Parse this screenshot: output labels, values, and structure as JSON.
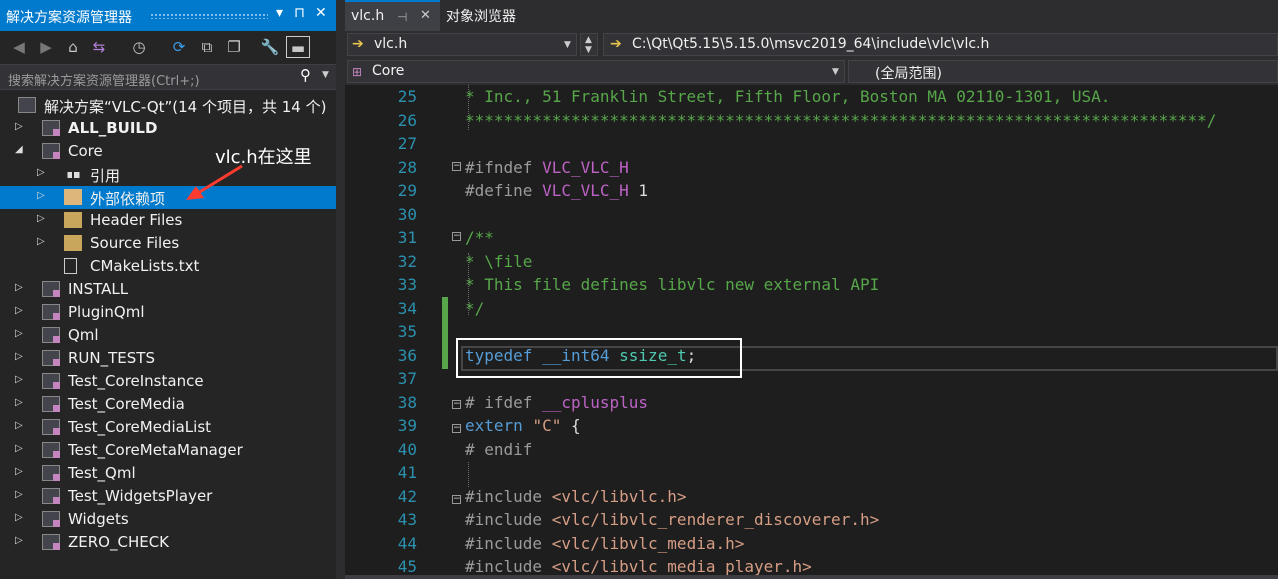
{
  "solution_explorer": {
    "title": "解决方案资源管理器",
    "title_buttons": [
      "▾",
      "⊓",
      "✕"
    ],
    "search_placeholder": "搜索解决方案资源管理器(Ctrl+;)",
    "tree": [
      {
        "label": "解决方案“VLC-Qt”(14 个项目，共 14 个)",
        "level": 0,
        "arrow": "",
        "icon": "solution-icon",
        "bold": false,
        "selected": false
      },
      {
        "label": "ALL_BUILD",
        "level": 1,
        "arrow": "▷",
        "icon": "project-icon",
        "bold": true,
        "selected": false
      },
      {
        "label": "Core",
        "level": 1,
        "arrow": "◢",
        "icon": "project-icon",
        "bold": false,
        "selected": false
      },
      {
        "label": "引用",
        "level": 2,
        "arrow": "▷",
        "icon": "references-icon",
        "bold": false,
        "selected": false
      },
      {
        "label": "外部依赖项",
        "level": 2,
        "arrow": "▷",
        "icon": "folder-icon",
        "bold": false,
        "selected": true
      },
      {
        "label": "Header Files",
        "level": 2,
        "arrow": "▷",
        "icon": "filter-folder-icon",
        "bold": false,
        "selected": false
      },
      {
        "label": "Source Files",
        "level": 2,
        "arrow": "▷",
        "icon": "filter-folder-icon",
        "bold": false,
        "selected": false
      },
      {
        "label": "CMakeLists.txt",
        "level": 2,
        "arrow": "",
        "icon": "text-file-icon",
        "bold": false,
        "selected": false
      },
      {
        "label": "INSTALL",
        "level": 1,
        "arrow": "▷",
        "icon": "project-icon",
        "bold": false,
        "selected": false
      },
      {
        "label": "PluginQml",
        "level": 1,
        "arrow": "▷",
        "icon": "project-icon",
        "bold": false,
        "selected": false
      },
      {
        "label": "Qml",
        "level": 1,
        "arrow": "▷",
        "icon": "project-icon",
        "bold": false,
        "selected": false
      },
      {
        "label": "RUN_TESTS",
        "level": 1,
        "arrow": "▷",
        "icon": "project-icon",
        "bold": false,
        "selected": false
      },
      {
        "label": "Test_CoreInstance",
        "level": 1,
        "arrow": "▷",
        "icon": "project-icon",
        "bold": false,
        "selected": false
      },
      {
        "label": "Test_CoreMedia",
        "level": 1,
        "arrow": "▷",
        "icon": "project-icon",
        "bold": false,
        "selected": false
      },
      {
        "label": "Test_CoreMediaList",
        "level": 1,
        "arrow": "▷",
        "icon": "project-icon",
        "bold": false,
        "selected": false
      },
      {
        "label": "Test_CoreMetaManager",
        "level": 1,
        "arrow": "▷",
        "icon": "project-icon",
        "bold": false,
        "selected": false
      },
      {
        "label": "Test_Qml",
        "level": 1,
        "arrow": "▷",
        "icon": "project-icon",
        "bold": false,
        "selected": false
      },
      {
        "label": "Test_WidgetsPlayer",
        "level": 1,
        "arrow": "▷",
        "icon": "project-icon",
        "bold": false,
        "selected": false
      },
      {
        "label": "Widgets",
        "level": 1,
        "arrow": "▷",
        "icon": "project-icon",
        "bold": false,
        "selected": false
      },
      {
        "label": "ZERO_CHECK",
        "level": 1,
        "arrow": "▷",
        "icon": "project-icon",
        "bold": false,
        "selected": false
      }
    ]
  },
  "annotation": {
    "text": "vlc.h在这里",
    "color": "#ff3b30"
  },
  "editor": {
    "tabs": [
      {
        "label": "vlc.h",
        "active": true,
        "pin": "⊣",
        "close": "✕"
      },
      {
        "label": "对象浏览器",
        "active": false
      }
    ],
    "file_combo": "vlc.h",
    "path": "C:\\Qt\\Qt5.15\\5.15.0\\msvc2019_64\\include\\vlc\\vlc.h",
    "scope_combo": "Core",
    "global_scope": "(全局范围)",
    "lines": [
      {
        "n": "25",
        "tokens": [
          {
            "t": "* Inc., 51 Franklin Street, Fifth Floor, Boston MA 02110-1301, USA.",
            "c": "com"
          }
        ]
      },
      {
        "n": "26",
        "tokens": [
          {
            "t": "*****************************************************************************/",
            "c": "com"
          }
        ]
      },
      {
        "n": "27",
        "tokens": []
      },
      {
        "n": "28",
        "tokens": [
          {
            "t": "#ifndef ",
            "c": "pre"
          },
          {
            "t": "VLC_VLC_H",
            "c": "mac"
          }
        ]
      },
      {
        "n": "29",
        "tokens": [
          {
            "t": "#define ",
            "c": "pre"
          },
          {
            "t": "VLC_VLC_H",
            "c": "mac"
          },
          {
            "t": " 1",
            "c": "txt"
          }
        ]
      },
      {
        "n": "30",
        "tokens": []
      },
      {
        "n": "31",
        "tokens": [
          {
            "t": "/**",
            "c": "com"
          }
        ]
      },
      {
        "n": "32",
        "tokens": [
          {
            "t": "* \\file",
            "c": "com"
          }
        ]
      },
      {
        "n": "33",
        "tokens": [
          {
            "t": "* This file defines libvlc new external API",
            "c": "com"
          }
        ]
      },
      {
        "n": "34",
        "tokens": [
          {
            "t": "*/",
            "c": "com"
          }
        ]
      },
      {
        "n": "35",
        "tokens": []
      },
      {
        "n": "36",
        "tokens": [
          {
            "t": "typedef",
            "c": "kw"
          },
          {
            "t": " ",
            "c": "txt"
          },
          {
            "t": "__int64",
            "c": "kw"
          },
          {
            "t": " ",
            "c": "txt"
          },
          {
            "t": "ssize_t",
            "c": "typ"
          },
          {
            "t": ";",
            "c": "txt"
          }
        ]
      },
      {
        "n": "37",
        "tokens": []
      },
      {
        "n": "38",
        "tokens": [
          {
            "t": "# ifdef ",
            "c": "pre"
          },
          {
            "t": "__cplusplus",
            "c": "mac"
          }
        ]
      },
      {
        "n": "39",
        "tokens": [
          {
            "t": "extern",
            "c": "kw"
          },
          {
            "t": " ",
            "c": "txt"
          },
          {
            "t": "\"C\"",
            "c": "str"
          },
          {
            "t": " {",
            "c": "txt"
          }
        ]
      },
      {
        "n": "40",
        "tokens": [
          {
            "t": "# endif",
            "c": "pre"
          }
        ]
      },
      {
        "n": "41",
        "tokens": []
      },
      {
        "n": "42",
        "tokens": [
          {
            "t": "#include ",
            "c": "pre"
          },
          {
            "t": "<vlc/libvlc.h>",
            "c": "str"
          }
        ]
      },
      {
        "n": "43",
        "tokens": [
          {
            "t": "#include ",
            "c": "pre"
          },
          {
            "t": "<vlc/libvlc_renderer_discoverer.h>",
            "c": "str"
          }
        ]
      },
      {
        "n": "44",
        "tokens": [
          {
            "t": "#include ",
            "c": "pre"
          },
          {
            "t": "<vlc/libvlc_media.h>",
            "c": "str"
          }
        ]
      },
      {
        "n": "45",
        "tokens": [
          {
            "t": "#include ",
            "c": "pre"
          },
          {
            "t": "<vlc/libvlc_media_player.h>",
            "c": "str"
          }
        ]
      }
    ]
  },
  "colors": {
    "accent": "#007acc",
    "comment": "#57a64a",
    "keyword": "#569cd6",
    "string": "#d69d85",
    "macro": "#bd63c5",
    "type": "#4ec9b0",
    "line_number": "#2b91af",
    "change_marker": "#57a64a"
  }
}
